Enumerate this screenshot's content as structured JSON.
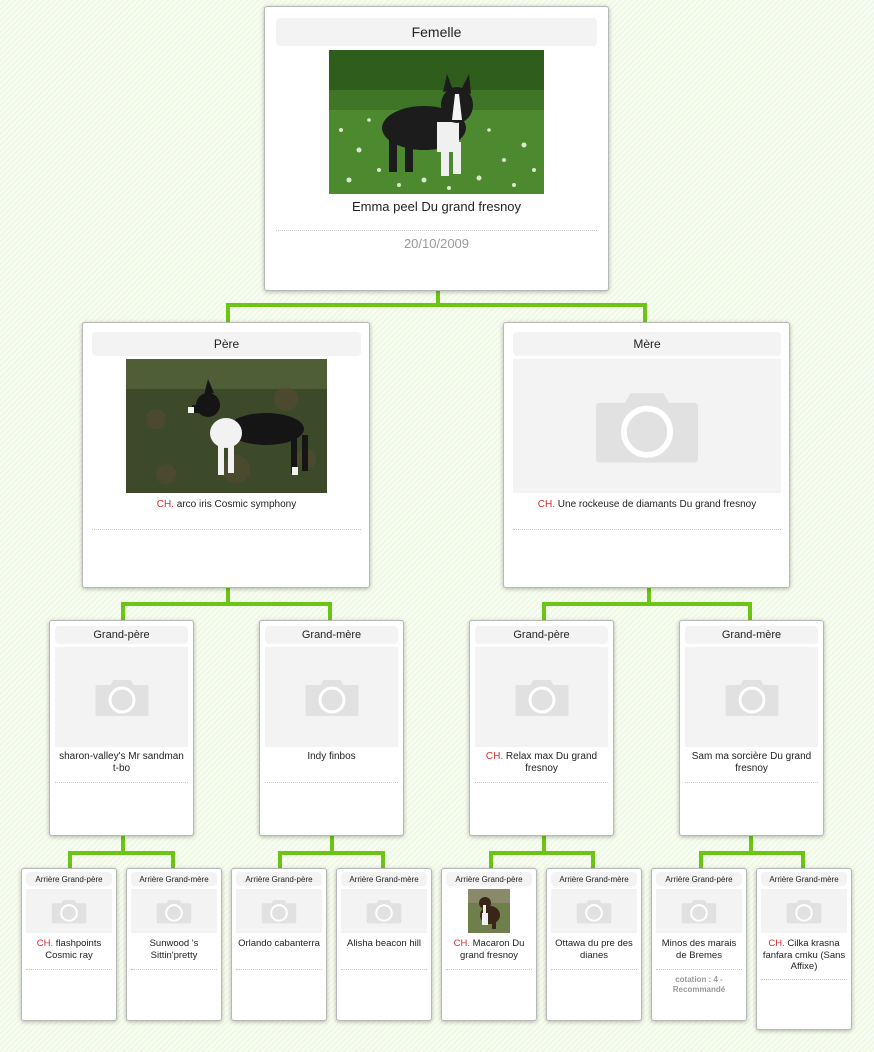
{
  "subject": {
    "label": "Femelle",
    "name": "Emma peel Du grand fresnoy",
    "date": "20/10/2009",
    "photo_icon": "boston-terrier-photo"
  },
  "parents": {
    "father": {
      "label": "Père",
      "prefix": "CH.",
      "name": "arco iris Cosmic symphony",
      "photo_icon": "boston-terrier-photo"
    },
    "mother": {
      "label": "Mère",
      "prefix": "CH.",
      "name": "Une rockeuse de diamants Du grand fresnoy",
      "photo_icon": "camera-icon"
    }
  },
  "grandparents": [
    {
      "label": "Grand-père",
      "prefix": "",
      "name": "sharon-valley's Mr sandman t-bo"
    },
    {
      "label": "Grand-mère",
      "prefix": "",
      "name": "Indy finbos"
    },
    {
      "label": "Grand-père",
      "prefix": "CH.",
      "name": "Relax max Du grand fresnoy"
    },
    {
      "label": "Grand-mère",
      "prefix": "",
      "name": "Sam ma sorcière Du grand fresnoy"
    }
  ],
  "great_grandparents": [
    {
      "label": "Arrière Grand-père",
      "prefix": "CH.",
      "name": "flashpoints Cosmic ray",
      "photo": false,
      "note": ""
    },
    {
      "label": "Arrière Grand-mère",
      "prefix": "",
      "name": "Sunwood 's Sittin'pretty",
      "photo": false,
      "note": ""
    },
    {
      "label": "Arrière Grand-père",
      "prefix": "",
      "name": "Orlando cabanterra",
      "photo": false,
      "note": ""
    },
    {
      "label": "Arrière Grand-mère",
      "prefix": "",
      "name": "Alisha beacon hill",
      "photo": false,
      "note": ""
    },
    {
      "label": "Arrière Grand-père",
      "prefix": "CH.",
      "name": "Macaron Du grand fresnoy",
      "photo": true,
      "note": ""
    },
    {
      "label": "Arrière Grand-mère",
      "prefix": "",
      "name": "Ottawa du pre des dianes",
      "photo": false,
      "note": ""
    },
    {
      "label": "Arrière Grand-père",
      "prefix": "",
      "name": "Minos des marais de Bremes",
      "photo": false,
      "note": "cotation : 4 - Recommandé"
    },
    {
      "label": "Arrière Grand-mère",
      "prefix": "CH.",
      "name": "Cilka krasna fanfara cmku (Sans Affixe)",
      "photo": false,
      "note": ""
    }
  ],
  "colors": {
    "connector": "#6cc417",
    "champion_prefix": "#d32f2f",
    "placeholder_bg": "#f3f3f3",
    "camera_icon": "#e1e1e1"
  }
}
